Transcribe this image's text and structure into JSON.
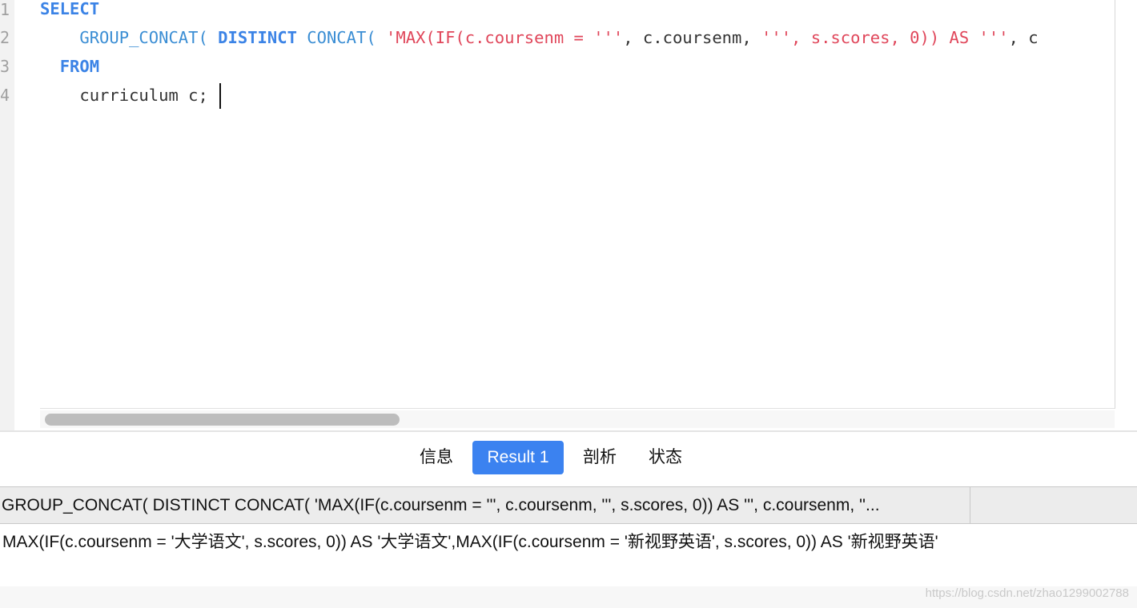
{
  "editor": {
    "line_numbers": [
      "1",
      "2",
      "3",
      "4"
    ],
    "line1": {
      "kw": "SELECT"
    },
    "line2": {
      "indent": "    ",
      "fn1": "GROUP_CONCAT(",
      "kw": "DISTINCT",
      "fn2": "CONCAT(",
      "str1": "'MAX(IF(c.coursenm = '''",
      "plain1": ", c.coursenm, ",
      "str2": "''', s.scores, 0)) AS '''",
      "plain2": ", c"
    },
    "line3": {
      "indent": "  ",
      "kw": "FROM"
    },
    "line4": {
      "indent": "    ",
      "text": "curriculum c;"
    }
  },
  "tabs": [
    {
      "label": "信息",
      "active": false
    },
    {
      "label": "Result 1",
      "active": true
    },
    {
      "label": "剖析",
      "active": false
    },
    {
      "label": "状态",
      "active": false
    }
  ],
  "result": {
    "column_header": "GROUP_CONCAT( DISTINCT CONCAT( 'MAX(IF(c.coursenm = ''', c.coursenm, ''', s.scores, 0)) AS ''', c.coursenm, ''...",
    "rows": [
      "MAX(IF(c.coursenm = '大学语文', s.scores, 0)) AS '大学语文',MAX(IF(c.coursenm = '新视野英语', s.scores, 0)) AS '新视野英语'"
    ]
  },
  "watermark": "https://blog.csdn.net/zhao1299002788",
  "colors": {
    "keyword": "#3b83e6",
    "function": "#3b8ed4",
    "string": "#e0465a",
    "active_tab": "#3b82f0"
  }
}
